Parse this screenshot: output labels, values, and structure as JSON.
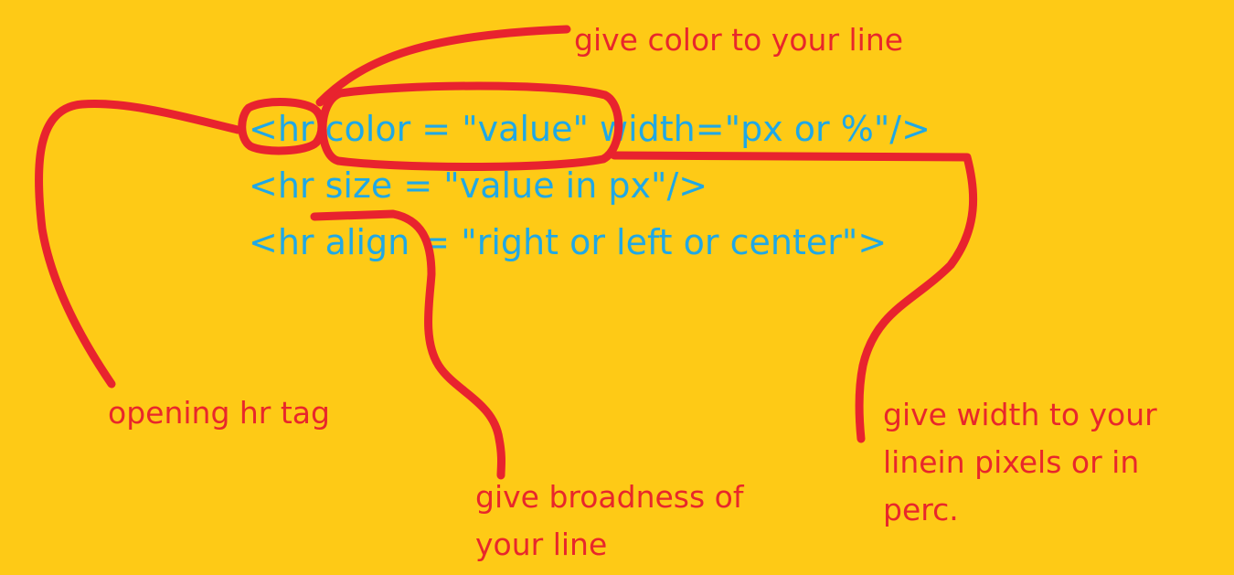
{
  "code": {
    "line1": "<hr color = \"value\" width=\"px or %\"/>",
    "line2": "<hr size = \"value in px\"/>",
    "line3": "<hr align = \"right or left or center\">"
  },
  "annotations": {
    "color": "give color to your line",
    "opening": "opening hr tag",
    "broadness_line1": "give broadness of",
    "broadness_line2": "your line",
    "width_line1": "give width to your",
    "width_line2": "linein pixels or in",
    "width_line3": "perc."
  },
  "colors": {
    "background": "#FECA16",
    "code_text": "#1FA8E6",
    "annotation_ink": "#E8232E"
  }
}
